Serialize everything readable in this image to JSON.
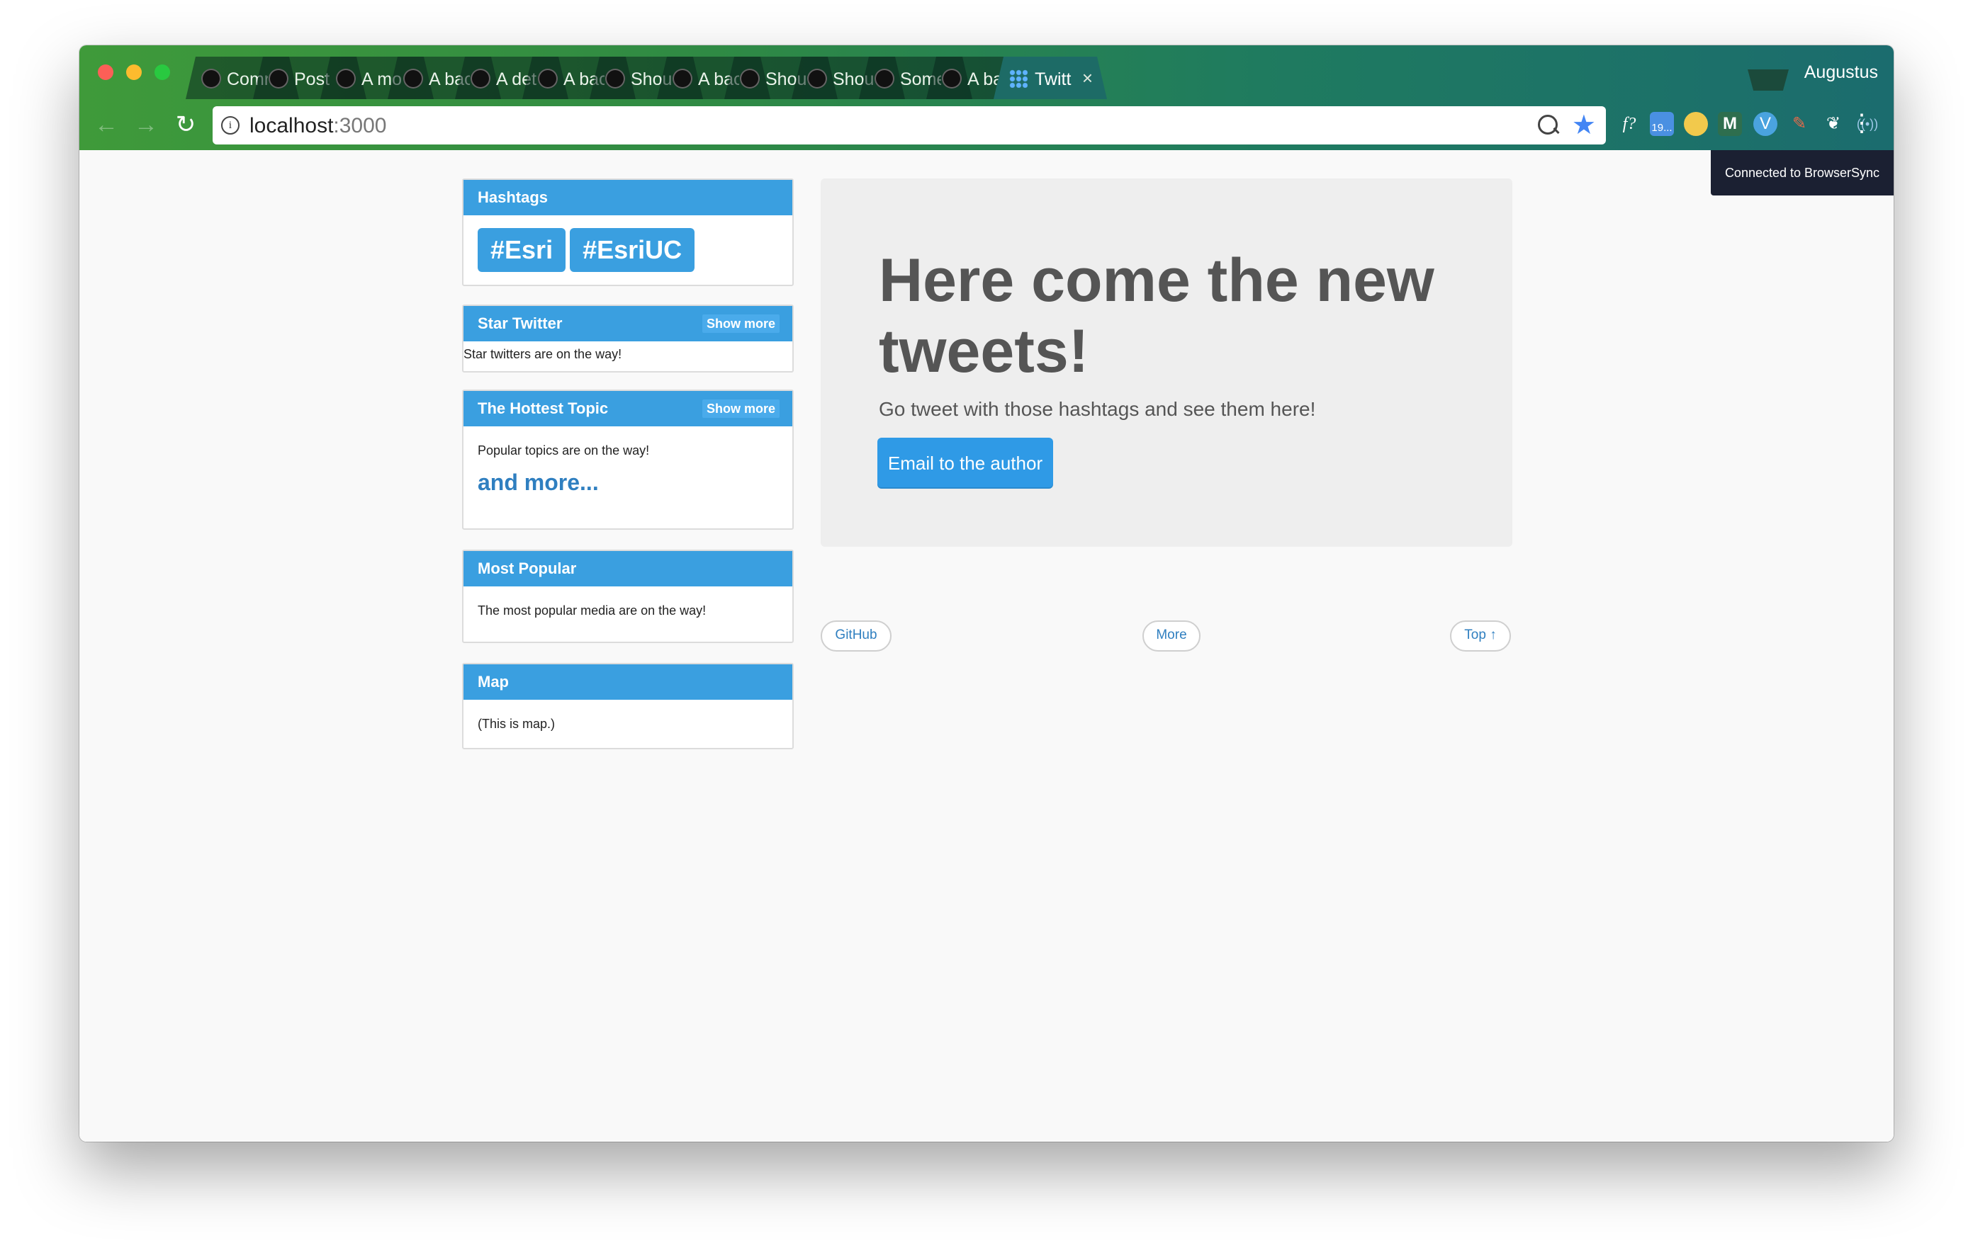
{
  "browser": {
    "profile_name": "Augustus",
    "tabs": [
      {
        "label": "Comr",
        "icon": "github-icon"
      },
      {
        "label": "Post",
        "icon": "github-icon"
      },
      {
        "label": "A mo",
        "icon": "github-icon"
      },
      {
        "label": "A bac",
        "icon": "github-icon"
      },
      {
        "label": "A det",
        "icon": "github-icon"
      },
      {
        "label": "A bac",
        "icon": "github-icon"
      },
      {
        "label": "Shou",
        "icon": "github-icon"
      },
      {
        "label": "A bac",
        "icon": "github-icon"
      },
      {
        "label": "Shou",
        "icon": "github-icon"
      },
      {
        "label": "Shou",
        "icon": "github-icon"
      },
      {
        "label": "Some",
        "icon": "github-icon"
      },
      {
        "label": "A bac",
        "icon": "github-icon"
      },
      {
        "label": "Twitt",
        "icon": "grid-icon",
        "active": true
      }
    ],
    "tab_close_glyph": "×",
    "url_host": "localhost",
    "url_port": ":3000",
    "extensions": {
      "calendar_badge": "19...",
      "formula_label": "f?",
      "m_label": "M"
    }
  },
  "browsersync_toast": "Connected to BrowserSync",
  "sidebar": {
    "hashtags": {
      "title": "Hashtags",
      "tags": [
        "#Esri",
        "#EsriUC"
      ]
    },
    "star_twitter": {
      "title": "Star Twitter",
      "show_more": "Show more",
      "body": "Star twitters are on the way!"
    },
    "hottest_topic": {
      "title": "The Hottest Topic",
      "show_more": "Show more",
      "body": "Popular topics are on the way!",
      "and_more": "and more..."
    },
    "most_popular": {
      "title": "Most Popular",
      "body": "The most popular media are on the way!"
    },
    "map": {
      "title": "Map",
      "body": "(This is map.)"
    }
  },
  "hero": {
    "headline": "Here come the new tweets!",
    "lead": "Go tweet with those hashtags and see them here!",
    "button": "Email to the author"
  },
  "footer_links": {
    "github": "GitHub",
    "more": "More",
    "top": "Top ↑"
  },
  "colors": {
    "accent": "#3a9fe0",
    "button": "#2f9ae6",
    "link": "#2f7fc0",
    "heading": "#555555",
    "toast_bg": "#1b2032"
  }
}
